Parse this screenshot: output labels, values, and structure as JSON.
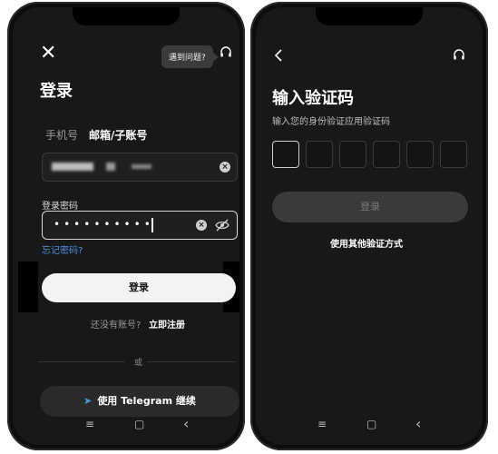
{
  "left": {
    "tooltip": "遇到问题?",
    "title": "登录",
    "tabs": [
      "手机号",
      "邮箱/子账号"
    ],
    "password_label": "登录密码",
    "password_mask": "••••••••••",
    "forgot": "忘记密码?",
    "login_btn": "登录",
    "no_account": "还没有账号?",
    "register": "立即注册",
    "or": "或",
    "telegram_btn": "使用 Telegram 继续"
  },
  "right": {
    "title": "输入验证码",
    "subtitle": "输入您的身份验证应用验证码",
    "login_btn": "登录",
    "other_methods": "使用其他验证方式"
  },
  "nav": {
    "menu": "≡",
    "home": "▢",
    "back": "‹"
  },
  "icons": {
    "close": "close-icon",
    "headset": "headset-icon",
    "back": "back-arrow-icon",
    "eye_off": "eye-off-icon",
    "clear": "clear-icon",
    "telegram": "telegram-icon"
  },
  "colors": {
    "background": "#0d0d0d",
    "screen": "#181818",
    "link": "#4a90e2",
    "button_light": "#f3f3f3",
    "telegram": "#3b9fe1"
  }
}
